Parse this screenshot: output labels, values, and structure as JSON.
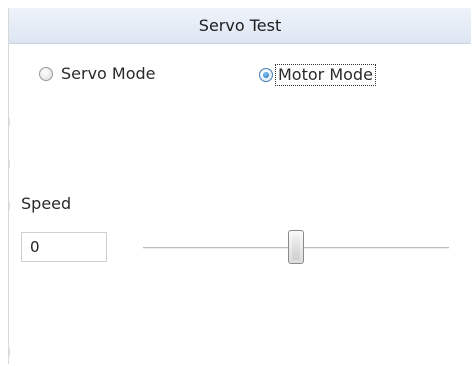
{
  "header": {
    "title": "Servo Test"
  },
  "modes": {
    "servo_label": "Servo Mode",
    "motor_label": "Motor Mode",
    "selected": "motor"
  },
  "speed": {
    "label": "Speed",
    "value": "0",
    "slider_fraction": 0.5
  }
}
